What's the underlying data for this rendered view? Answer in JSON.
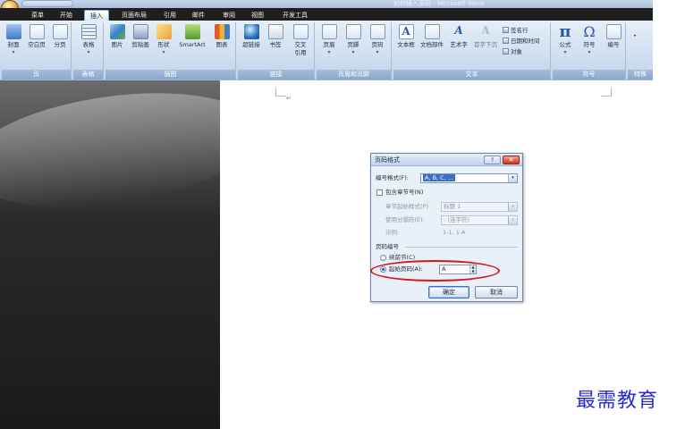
{
  "window": {
    "title": "如何插入页码 - Microsoft Word"
  },
  "tabs": [
    {
      "label": "菜单"
    },
    {
      "label": "开始"
    },
    {
      "label": "插入",
      "active": true
    },
    {
      "label": "页面布局"
    },
    {
      "label": "引用"
    },
    {
      "label": "邮件"
    },
    {
      "label": "审阅"
    },
    {
      "label": "视图"
    },
    {
      "label": "开发工具"
    }
  ],
  "ribbon": {
    "groups": {
      "pages": {
        "label": "页",
        "buttons": [
          "封面",
          "空白页",
          "分页"
        ]
      },
      "tables": {
        "label": "表格",
        "buttons": [
          "表格"
        ]
      },
      "illustrations": {
        "label": "插图",
        "buttons": [
          "图片",
          "剪贴画",
          "形状",
          "SmartArt",
          "图表"
        ]
      },
      "links": {
        "label": "链接",
        "buttons": [
          "超链接",
          "书签",
          "交叉引用"
        ]
      },
      "header_footer": {
        "label": "页眉和页脚",
        "buttons": [
          "页眉",
          "页脚",
          "页码"
        ]
      },
      "text": {
        "label": "文本",
        "buttons": [
          "文本框",
          "文档部件",
          "艺术字",
          "首字下沉"
        ],
        "small": [
          "签名行",
          "日期和时间",
          "对象"
        ]
      },
      "symbols": {
        "label": "符号",
        "buttons": [
          "公式",
          "符号",
          "编号"
        ]
      },
      "special": {
        "label": "特殊"
      }
    },
    "dropdown_glyph": "▾"
  },
  "dialog": {
    "title": "页码格式",
    "help_label": "?",
    "close_label": "✕",
    "number_format_label": "编号格式(F):",
    "number_format_value": "A, B, C, ...",
    "include_chapter_label": "包含章节号(N)",
    "chapter_style_label": "章节起始样式(P)",
    "chapter_style_value": "标题 1",
    "separator_label": "使用分隔符(E):",
    "separator_value": "-  (连字符)",
    "example_label": "示例:",
    "example_value": "1-1, 1-A",
    "page_numbering_label": "页码编号",
    "continue_label": "续前节(C)",
    "start_at_label": "起始页码(A):",
    "start_at_value": "A",
    "ok_label": "确定",
    "cancel_label": "取消"
  },
  "document": {
    "paragraph_mark": "↵"
  },
  "watermark": "最需教育",
  "colors": {
    "highlight": "#d6161c",
    "accent": "#3a6fc4",
    "watermark": "#2a2ad0"
  }
}
